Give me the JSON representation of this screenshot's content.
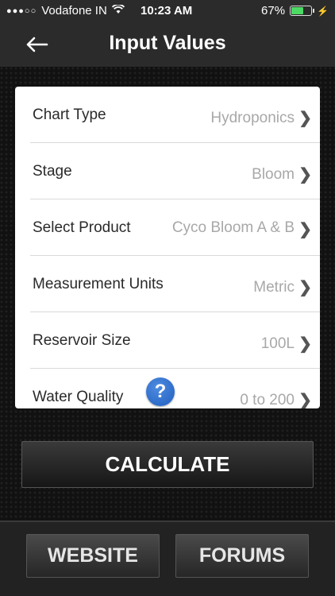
{
  "status_bar": {
    "carrier": "Vodafone IN",
    "time": "10:23 AM",
    "battery_percent": "67%",
    "battery_level": 0.67,
    "signal_dots": "●●●○○",
    "wifi_icon": "wifi-icon",
    "charging_icon": "bolt-icon"
  },
  "nav": {
    "title": "Input Values",
    "back_icon": "arrow-left-icon"
  },
  "form": {
    "rows": [
      {
        "label": "Chart Type",
        "value": "Hydroponics"
      },
      {
        "label": "Stage",
        "value": "Bloom"
      },
      {
        "label": "Select Product",
        "value": "Cyco Bloom A & B"
      },
      {
        "label": "Measurement Units",
        "value": "Metric"
      },
      {
        "label": "Reservoir Size",
        "value": "100L"
      },
      {
        "label": "Water Quality",
        "value": "0 to 200"
      }
    ],
    "help_icon_glyph": "?"
  },
  "calculate_label": "CALCULATE",
  "bottom": {
    "website_label": "WEBSITE",
    "forums_label": "FORUMS"
  },
  "colors": {
    "battery_green": "#4cd964",
    "help_blue": "#1f5fbf"
  }
}
